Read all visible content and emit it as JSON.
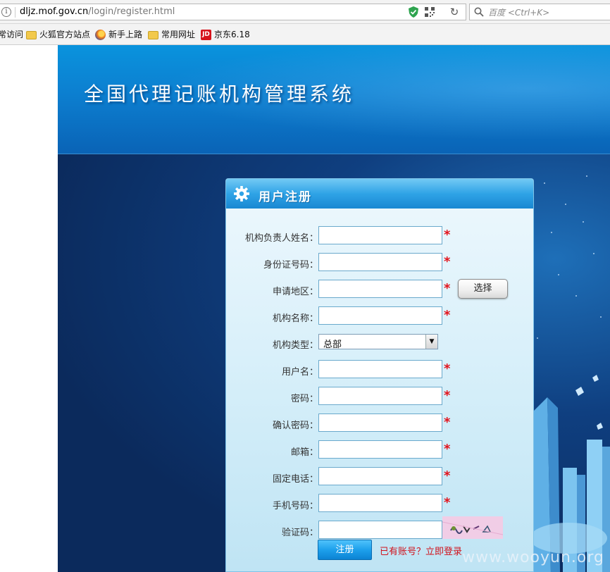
{
  "browser": {
    "url_host": "dljz.mof.gov.cn",
    "url_path": "/login/register.html",
    "search_placeholder": "百度 <Ctrl+K>"
  },
  "bookmarks": [
    {
      "label": "常访问",
      "icon": "none"
    },
    {
      "label": "火狐官方站点",
      "icon": "folder-icon"
    },
    {
      "label": "新手上路",
      "icon": "firefox-icon"
    },
    {
      "label": "常用网址",
      "icon": "folder-icon"
    },
    {
      "label": "京东6.18",
      "icon": "jd-icon"
    }
  ],
  "header": {
    "title": "全国代理记账机构管理系统"
  },
  "panel": {
    "title": "用户注册",
    "fields": [
      {
        "label": "机构负责人姓名：",
        "value": "",
        "required": true
      },
      {
        "label": "身份证号码：",
        "value": "",
        "required": true
      },
      {
        "label": "申请地区：",
        "value": "",
        "required": true
      },
      {
        "label": "机构名称：",
        "value": "",
        "required": true
      },
      {
        "label": "机构类型：",
        "value": "总部",
        "required": false
      },
      {
        "label": "用户名：",
        "value": "",
        "required": true
      },
      {
        "label": "密码：",
        "value": "",
        "required": true
      },
      {
        "label": "确认密码：",
        "value": "",
        "required": true
      },
      {
        "label": "邮箱：",
        "value": "",
        "required": true
      },
      {
        "label": "固定电话：",
        "value": "",
        "required": true
      },
      {
        "label": "手机号码：",
        "value": "",
        "required": true
      },
      {
        "label": "验证码：",
        "value": "",
        "required": false
      }
    ],
    "required_mark": "*",
    "select_button": "选择",
    "submit": "注册",
    "login_link": "已有账号？立即登录"
  },
  "watermark": "www.wooyun.org",
  "colors": {
    "header_blue": "#0c7fd0",
    "panel_head": "#2fa3e6",
    "required_red": "#e3121b",
    "link_red": "#d0121b"
  }
}
